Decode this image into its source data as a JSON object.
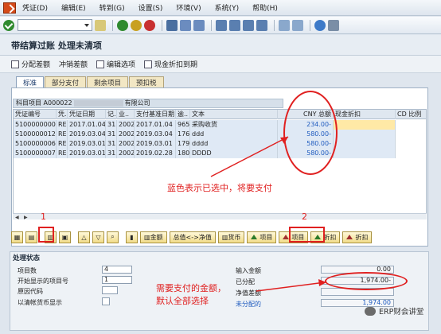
{
  "menu": [
    "凭证(D)",
    "编辑(E)",
    "转到(G)",
    "设置(S)",
    "环境(V)",
    "系统(Y)",
    "帮助(H)"
  ],
  "title": "带结算过账 处理未清项",
  "app_toolbar": [
    "分配差额",
    "冲销差额",
    "编辑选项",
    "现金折扣到期"
  ],
  "tabs": [
    "标准",
    "部分支付",
    "剩余项目",
    "预扣税"
  ],
  "account": {
    "label": "科目项目 A000022",
    "suffix": "有限公司"
  },
  "grid": {
    "headers": [
      "凭证编号",
      "凭..",
      "凭证日期",
      "记..",
      "业..",
      "支付基准日期",
      "逾..",
      "文本",
      "CNY 总额",
      "现金折扣",
      "CD 比例"
    ],
    "rows": [
      [
        "5100000000",
        "RE",
        "2017.01.04",
        "31",
        "2002",
        "2017.01.04",
        "965",
        "采购收货",
        "234.00-",
        "",
        ""
      ],
      [
        "5100000012",
        "RE",
        "2019.03.04",
        "31",
        "2002",
        "2019.03.04",
        "176",
        "ddd",
        "580.00-",
        "",
        ""
      ],
      [
        "5100000006",
        "RE",
        "2019.03.01",
        "31",
        "2002",
        "2019.03.01",
        "179",
        "dddd",
        "580.00-",
        "",
        ""
      ],
      [
        "5100000007",
        "RE",
        "2019.03.01",
        "31",
        "2002",
        "2019.02.28",
        "180",
        "DDDD",
        "580.00-",
        "",
        ""
      ]
    ]
  },
  "action_buttons": [
    "金额",
    "总值<->净值",
    "货币",
    "项目",
    "项目",
    "折扣",
    "折扣"
  ],
  "status": {
    "title": "处理状态",
    "labels": [
      "项目数",
      "开始显示的项目号",
      "原因代码",
      "以清帐货币显示"
    ],
    "values": [
      "4",
      "1"
    ],
    "sum_labels": [
      "输入金额",
      "已分配",
      "净值差额",
      "未分配的"
    ],
    "sum_values": [
      "0.00",
      "1,974.00-",
      "",
      "1,974.00"
    ]
  },
  "annotations": {
    "num1": "1",
    "num2": "2",
    "blue_note": "蓝色表示已选中，将要支付",
    "pay_note_1": "需要支付的金额，",
    "pay_note_2": "默认全部选择"
  },
  "watermark": "ERP财会讲堂",
  "colors": {
    "accent_red": "#e02020",
    "selected_blue": "#1f5bbf",
    "cash_yellow": "#ffe9a6"
  }
}
